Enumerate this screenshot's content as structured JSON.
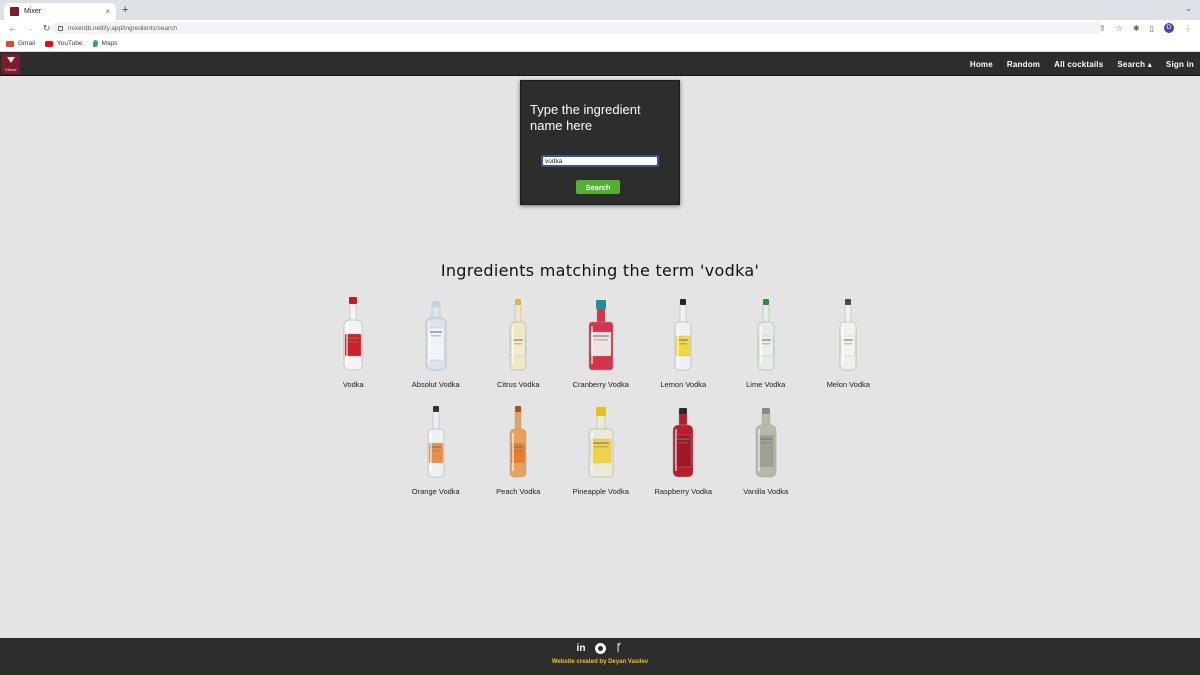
{
  "browser": {
    "tab_title": "Mixer",
    "tab_close": "×",
    "new_tab": "+",
    "menu": "⌄",
    "url": "mixerdb.netlify.app/ingredients/search",
    "profile_initial": "D",
    "bookmarks": [
      {
        "label": "Gmail",
        "icon": "gmail-icon"
      },
      {
        "label": "YouTube",
        "icon": "youtube-icon"
      },
      {
        "label": "Maps",
        "icon": "maps-icon"
      }
    ]
  },
  "nav": {
    "logo_text": "Mixer",
    "links": [
      "Home",
      "Random",
      "All cocktails",
      "Search ▴",
      "Sign in"
    ]
  },
  "search": {
    "prompt": "Type the ingredient name here",
    "value": "vodka",
    "button": "Search"
  },
  "results": {
    "heading": "Ingredients matching the term 'vodka'",
    "items": [
      {
        "name": "Vodka",
        "glass": "#f4f4f4",
        "label": "#d0202a",
        "cap": "#c41a24",
        "shape": "tall"
      },
      {
        "name": "Absolut Vodka",
        "glass": "#d9e3ec",
        "label": "#f0f4f8",
        "cap": "#c8d2dc",
        "shape": "absolut"
      },
      {
        "name": "Citrus Vodka",
        "glass": "#efe6c6",
        "label": "#f3ebd0",
        "cap": "#d8b34a",
        "shape": "slim"
      },
      {
        "name": "Cranberry Vodka",
        "glass": "#d4354a",
        "label": "#f2e3e3",
        "cap": "#1c8f9a",
        "shape": "square"
      },
      {
        "name": "Lemon Vodka",
        "glass": "#eef1f3",
        "label": "#f1d93a",
        "cap": "#222222",
        "shape": "slim"
      },
      {
        "name": "Lime Vodka",
        "glass": "#e4ece4",
        "label": "#e8f0e8",
        "cap": "#2f8a3a",
        "shape": "slim"
      },
      {
        "name": "Melon Vodka",
        "glass": "#f1f1ea",
        "label": "#f4f4ee",
        "cap": "#4a4a4a",
        "shape": "slim"
      },
      {
        "name": "Orange Vodka",
        "glass": "#eef1f4",
        "label": "#e9914a",
        "cap": "#333333",
        "shape": "slim"
      },
      {
        "name": "Peach Vodka",
        "glass": "#e7a35a",
        "label": "#e87d2e",
        "cap": "#b34d1f",
        "shape": "slim"
      },
      {
        "name": "Pineapple Vodka",
        "glass": "#ece9d8",
        "label": "#f0d24a",
        "cap": "#e8c21a",
        "shape": "square"
      },
      {
        "name": "Raspberry Vodka",
        "glass": "#b81d2c",
        "label": "#a01825",
        "cap": "#2a2a2a",
        "shape": "absolut"
      },
      {
        "name": "Vanilla Vodka",
        "glass": "#b8b9ad",
        "label": "#9fa096",
        "cap": "#8b8c82",
        "shape": "absolut"
      }
    ]
  },
  "footer": {
    "icons": [
      {
        "name": "linkedin-icon",
        "glyph": "in"
      },
      {
        "name": "github-icon",
        "glyph": ""
      },
      {
        "name": "fork-icon",
        "glyph": "ᚴ"
      }
    ],
    "credit": "Website created by Deyan Vasilev"
  },
  "colors": {
    "page_bg": "#e4e4e4",
    "nav_bg": "#2d2d2b",
    "button_green": "#52b133",
    "credit_yellow": "#e8c31a"
  }
}
